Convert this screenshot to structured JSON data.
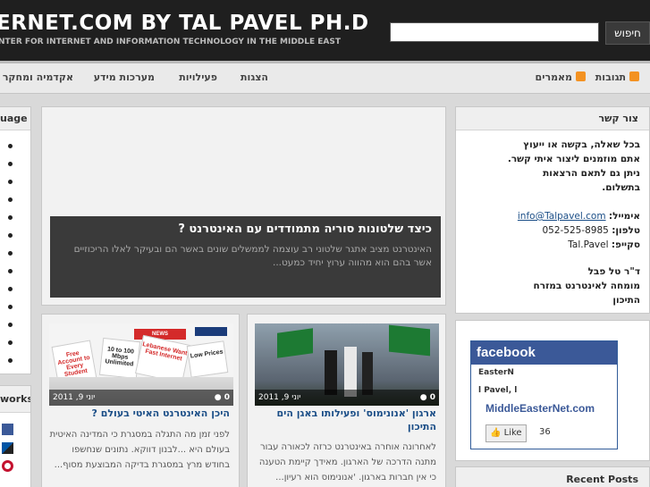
{
  "header": {
    "title": "ERNET.COM BY TAL PAVEL PH.D",
    "tagline": "NTER FOR INTERNET AND INFORMATION TECHNOLOGY IN THE MIDDLE EAST",
    "search_button": "חיפוש",
    "search_value": ""
  },
  "nav": {
    "items": [
      "תגובות",
      "מאמרים",
      "הצגות",
      "פעילויות",
      "מערכות מידע",
      "אקדמיה ומחקר"
    ]
  },
  "left": {
    "language_title": "uage",
    "networks_title": "works"
  },
  "featured": {
    "title": "כיצד שלטונות סוריה מתמודדים עם האינטרנט ?",
    "text": "האינטרנט מציב אתגר שלטוני רב עוצמה לממשלים שונים באשר הם ובעיקר לאלו הריכוזיים אשר בהם הוא מהווה ערוץ יחיד כמעט..."
  },
  "posts": [
    {
      "title": "היכן האינטרנט האיטי בעולם ?",
      "date": "יוני 9, 2011",
      "comments": "0",
      "text": [
        "לפני זמן מה התגלה במסגרת כי המדינה האיטית",
        "בעולם היא ...לבנון דווקא. נתונים שנחשפו",
        "בחודש מרץ במסגרת בדיקה המבוצעת מסוף..."
      ],
      "image_signs": [
        "Free Account to Every Student",
        "10 to 100 Mbps Unlimited",
        "Lebanese Want Fast Internet",
        "Low Prices"
      ]
    },
    {
      "title": "ארגון 'אנונימוס' ופעילותו באגן הים התיכון",
      "date": "יוני 9, 2011",
      "comments": "0",
      "text": [
        "לאחרונה אוחרה באינטרנט כרזה לכאורה עבור",
        "מתנה הדרכה של הארגון. מאידך קיימת הטענה",
        "כי אין חברות בארגון. 'אנונימוס הוא רעיון..."
      ]
    }
  ],
  "contact": {
    "title": "צור קשר",
    "intro": [
      "בכל שאלה, בקשה או ייעוץ",
      "אתם מוזמנים ליצור איתי קשר.",
      "ניתן גם לתאם הרצאות",
      "בתשלום."
    ],
    "email_label": "אימייל:",
    "email": "info@Talpavel.com",
    "phone_label": "טלפון:",
    "phone": "052-525-8985",
    "skype_label": "סקייפ:",
    "skype": "Tal.Pavel",
    "name": "ד\"ר טל פבל",
    "role": [
      "מומחה לאינטרנט במזרח",
      "התיכון"
    ]
  },
  "facebook": {
    "brand": "facebook",
    "line1": "EasterN",
    "line2": "l Pavel, l",
    "page_name": "MiddleEasterNet.com",
    "like_label": "Like",
    "likes": "36"
  },
  "recent": {
    "title": "Recent Posts"
  }
}
